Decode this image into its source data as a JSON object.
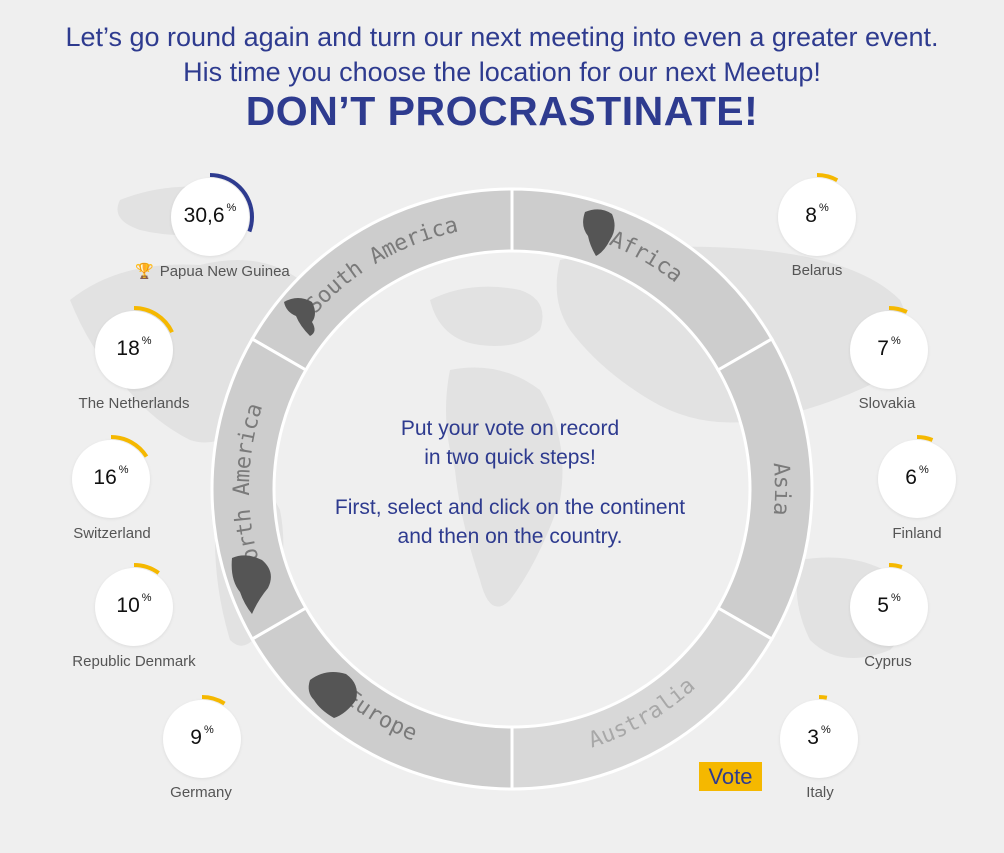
{
  "header": {
    "line1": "Let’s go round again and turn our next meeting into even a greater event.",
    "line2": "His time you choose the location for our next Meetup!",
    "line3": "DON’T PROCRASTINATE!"
  },
  "instructions": {
    "line1": "Put your vote on record",
    "line2": "in two quick steps!",
    "line3": "First, select and click on the continent",
    "line4": "and then on the country."
  },
  "continents": [
    "South America",
    "Africa",
    "Asia",
    "Australia",
    "Europe",
    "North America"
  ],
  "countries": [
    {
      "name": "Papua New Guinea",
      "percent": "30,6",
      "value": 30.6,
      "leader": true
    },
    {
      "name": "The Netherlands",
      "percent": "18",
      "value": 18
    },
    {
      "name": "Switzerland",
      "percent": "16",
      "value": 16
    },
    {
      "name": "Republic Denmark",
      "percent": "10",
      "value": 10
    },
    {
      "name": "Germany",
      "percent": "9",
      "value": 9
    },
    {
      "name": "Belarus",
      "percent": "8",
      "value": 8
    },
    {
      "name": "Slovakia",
      "percent": "7",
      "value": 7
    },
    {
      "name": "Finland",
      "percent": "6",
      "value": 6
    },
    {
      "name": "Cyprus",
      "percent": "5",
      "value": 5
    },
    {
      "name": "Italy",
      "percent": "3",
      "value": 3
    }
  ],
  "percent_sign": "%",
  "vote_label": "Vote",
  "colors": {
    "primary": "#2e3b8f",
    "accent": "#f5b800",
    "leader_arc": "#2e3b8f",
    "ring": "#d2d2d2",
    "ring_border": "#ffffff"
  }
}
